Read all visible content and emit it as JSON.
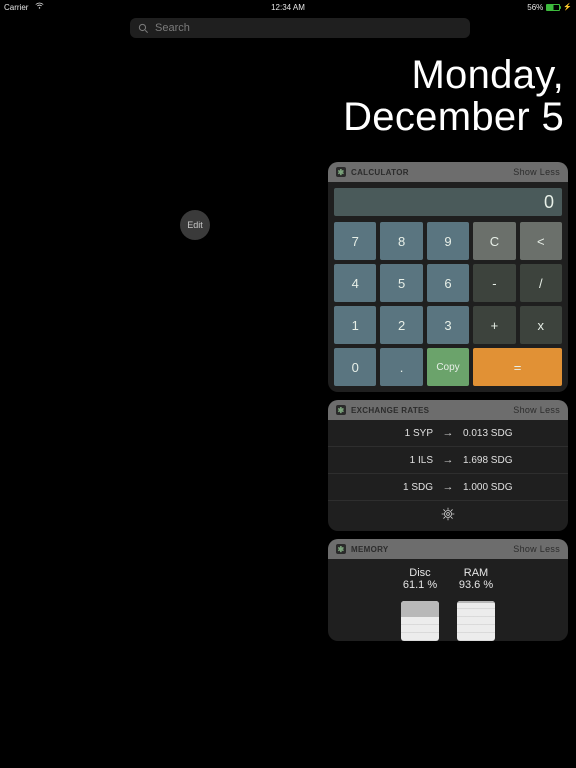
{
  "statusbar": {
    "carrier": "Carrier",
    "time": "12:34 AM",
    "battery_pct": "56%"
  },
  "search": {
    "placeholder": "Search"
  },
  "date": {
    "line1": "Monday,",
    "line2": "December 5"
  },
  "edit_label": "Edit",
  "calculator": {
    "title": "CALCULATOR",
    "header_action": "Show Less",
    "display_value": "0",
    "keys": {
      "k7": "7",
      "k8": "8",
      "k9": "9",
      "clear": "C",
      "back": "<",
      "k4": "4",
      "k5": "5",
      "k6": "6",
      "minus": "-",
      "div": "/",
      "k1": "1",
      "k2": "2",
      "k3": "3",
      "plus": "+",
      "mul": "x",
      "k0": "0",
      "dot": ".",
      "copy": "Copy",
      "eq": "="
    }
  },
  "exchange": {
    "title": "EXCHANGE RATES",
    "header_action": "Show Less",
    "rows": [
      {
        "from": "1 SYP",
        "to": "0.013 SDG"
      },
      {
        "from": "1 ILS",
        "to": "1.698 SDG"
      },
      {
        "from": "1 SDG",
        "to": "1.000 SDG"
      }
    ]
  },
  "memory": {
    "title": "MEMORY",
    "header_action": "Show Less",
    "cols": [
      {
        "label": "Disc",
        "value": "61.1 %",
        "used_pct": 39
      },
      {
        "label": "RAM",
        "value": "93.6 %",
        "used_pct": 6
      }
    ]
  }
}
